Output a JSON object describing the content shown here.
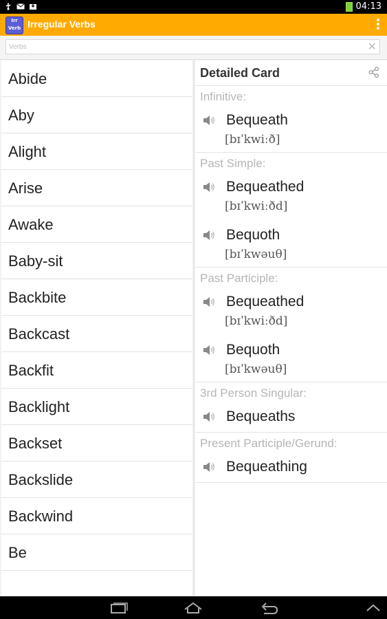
{
  "status_bar": {
    "time": "04:13",
    "icons": [
      "usb-icon",
      "mail-icon",
      "download-icon",
      "battery-icon"
    ]
  },
  "action_bar": {
    "title": "Irregular Verbs",
    "logo_text": [
      "Irr",
      "Verb"
    ],
    "overflow_icon": "overflow-menu-icon",
    "background": "#ffaa00"
  },
  "search": {
    "placeholder": "Verbs",
    "clear_icon": "close-icon"
  },
  "verbs": [
    "Abide",
    "Aby",
    "Alight",
    "Arise",
    "Awake",
    "Baby-sit",
    "Backbite",
    "Backcast",
    "Backfit",
    "Backlight",
    "Backset",
    "Backslide",
    "Backwind",
    "Be"
  ],
  "detail": {
    "title": "Detailed Card",
    "share_icon": "share-icon",
    "sections": [
      {
        "label": "Infinitive:",
        "forms": [
          {
            "word": "Bequeath",
            "ipa": "[bɪˈkwiːð]"
          }
        ]
      },
      {
        "label": "Past Simple:",
        "forms": [
          {
            "word": "Bequeathed",
            "ipa": "[bɪˈkwiːðd]"
          },
          {
            "word": "Bequoth",
            "ipa": "[bɪˈkwəuθ]"
          }
        ]
      },
      {
        "label": "Past Participle:",
        "forms": [
          {
            "word": "Bequeathed",
            "ipa": "[bɪˈkwiːðd]"
          },
          {
            "word": "Bequoth",
            "ipa": "[bɪˈkwəuθ]"
          }
        ]
      },
      {
        "label": "3rd Person Singular:",
        "forms": [
          {
            "word": "Bequeaths",
            "ipa": ""
          }
        ]
      },
      {
        "label": "Present Participle/Gerund:",
        "forms": [
          {
            "word": "Bequeathing",
            "ipa": ""
          }
        ]
      }
    ]
  },
  "nav_bar": {
    "buttons": [
      "recent-apps-icon",
      "home-icon",
      "back-icon",
      "expand-icon"
    ]
  }
}
